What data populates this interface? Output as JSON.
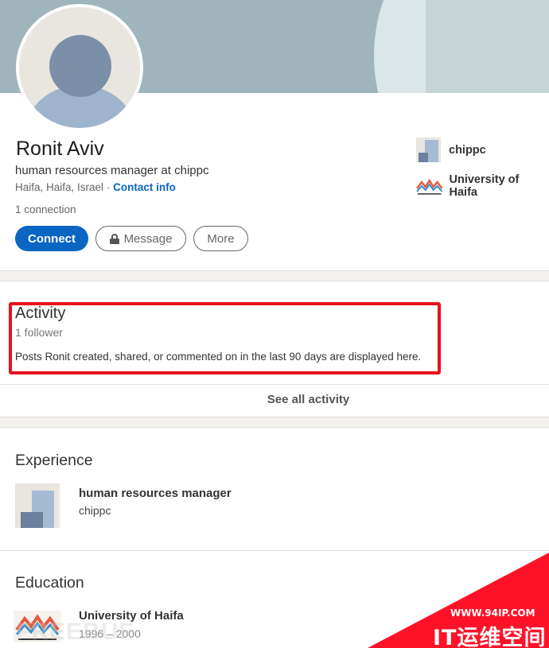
{
  "profile": {
    "name": "Ronit Aviv",
    "headline": "human resources manager at chippc",
    "location": "Haifa, Haifa, Israel",
    "location_sep": "·",
    "contact_label": "Contact info",
    "connections": "1 connection"
  },
  "actions": {
    "connect_label": "Connect",
    "message_label": "Message",
    "more_label": "More"
  },
  "side": {
    "company": "chippc",
    "school": "University of Haifa"
  },
  "activity": {
    "title": "Activity",
    "followers": "1 follower",
    "description": "Posts Ronit created, shared, or commented on in the last 90 days are displayed here.",
    "see_all_label": "See all activity"
  },
  "experience": {
    "title": "Experience",
    "role": "human resources manager",
    "company": "chippc"
  },
  "education": {
    "title": "Education",
    "school": "University of Haifa",
    "years": "1996 – 2000"
  },
  "watermark": {
    "faint": "FREEBUF",
    "url": "WWW.94IP.COM",
    "name": "IT运维空间"
  },
  "colors": {
    "primary": "#0a66c2",
    "highlight": "#e8101f",
    "banner": "#a0b4bb"
  },
  "icons": {
    "lock": "lock-icon"
  }
}
